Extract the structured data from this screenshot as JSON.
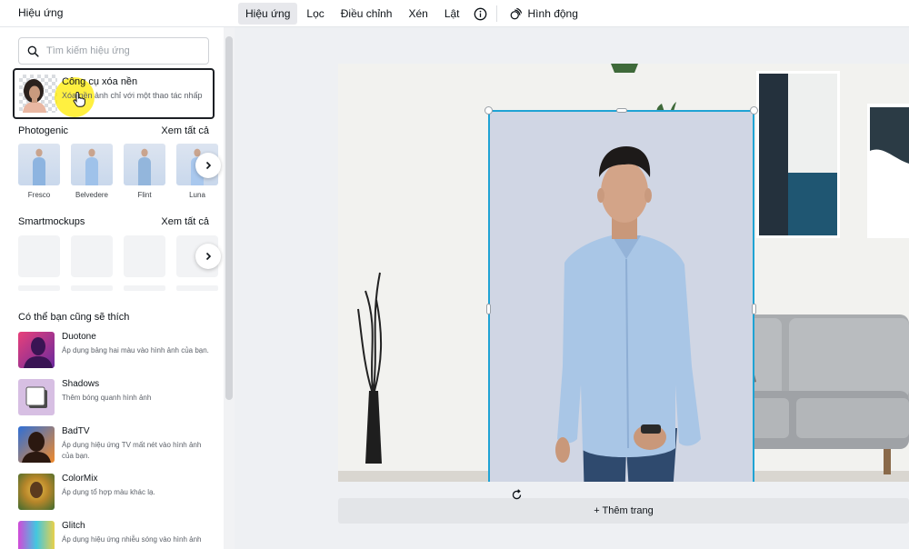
{
  "panel": {
    "title": "Hiệu ứng",
    "search_placeholder": "Tìm kiếm hiệu ứng",
    "bg_remover": {
      "title": "Công cụ xóa nền",
      "desc": "Xóa nền ảnh chỉ với một thao tác nhấp"
    },
    "photogenic": {
      "heading": "Photogenic",
      "see_all": "Xem tất cả",
      "items": [
        {
          "label": "Fresco"
        },
        {
          "label": "Belvedere"
        },
        {
          "label": "Flint"
        },
        {
          "label": "Luna"
        }
      ]
    },
    "smartmockups": {
      "heading": "Smartmockups",
      "see_all": "Xem tất cả"
    },
    "suggest": {
      "heading": "Có thể bạn cũng sẽ thích",
      "items": [
        {
          "title": "Duotone",
          "desc": "Áp dụng bảng hai màu vào hình ảnh của bạn."
        },
        {
          "title": "Shadows",
          "desc": "Thêm bóng quanh hình ảnh"
        },
        {
          "title": "BadTV",
          "desc": "Áp dụng hiệu ứng TV mất nét vào hình ảnh của bạn."
        },
        {
          "title": "ColorMix",
          "desc": "Áp dụng tổ hợp màu khác lạ."
        },
        {
          "title": "Glitch",
          "desc": "Áp dụng hiệu ứng nhiễu sóng vào hình ảnh"
        }
      ]
    }
  },
  "toolbar": {
    "effects": "Hiệu ứng",
    "filter": "Lọc",
    "adjust": "Điều chỉnh",
    "crop": "Xén",
    "flip": "Lật",
    "animate": "Hình động"
  },
  "canvas": {
    "add_page": "+ Thêm trang"
  },
  "colors": {
    "selection": "#1fa3d4",
    "active_tab": "#e7e8ec"
  }
}
